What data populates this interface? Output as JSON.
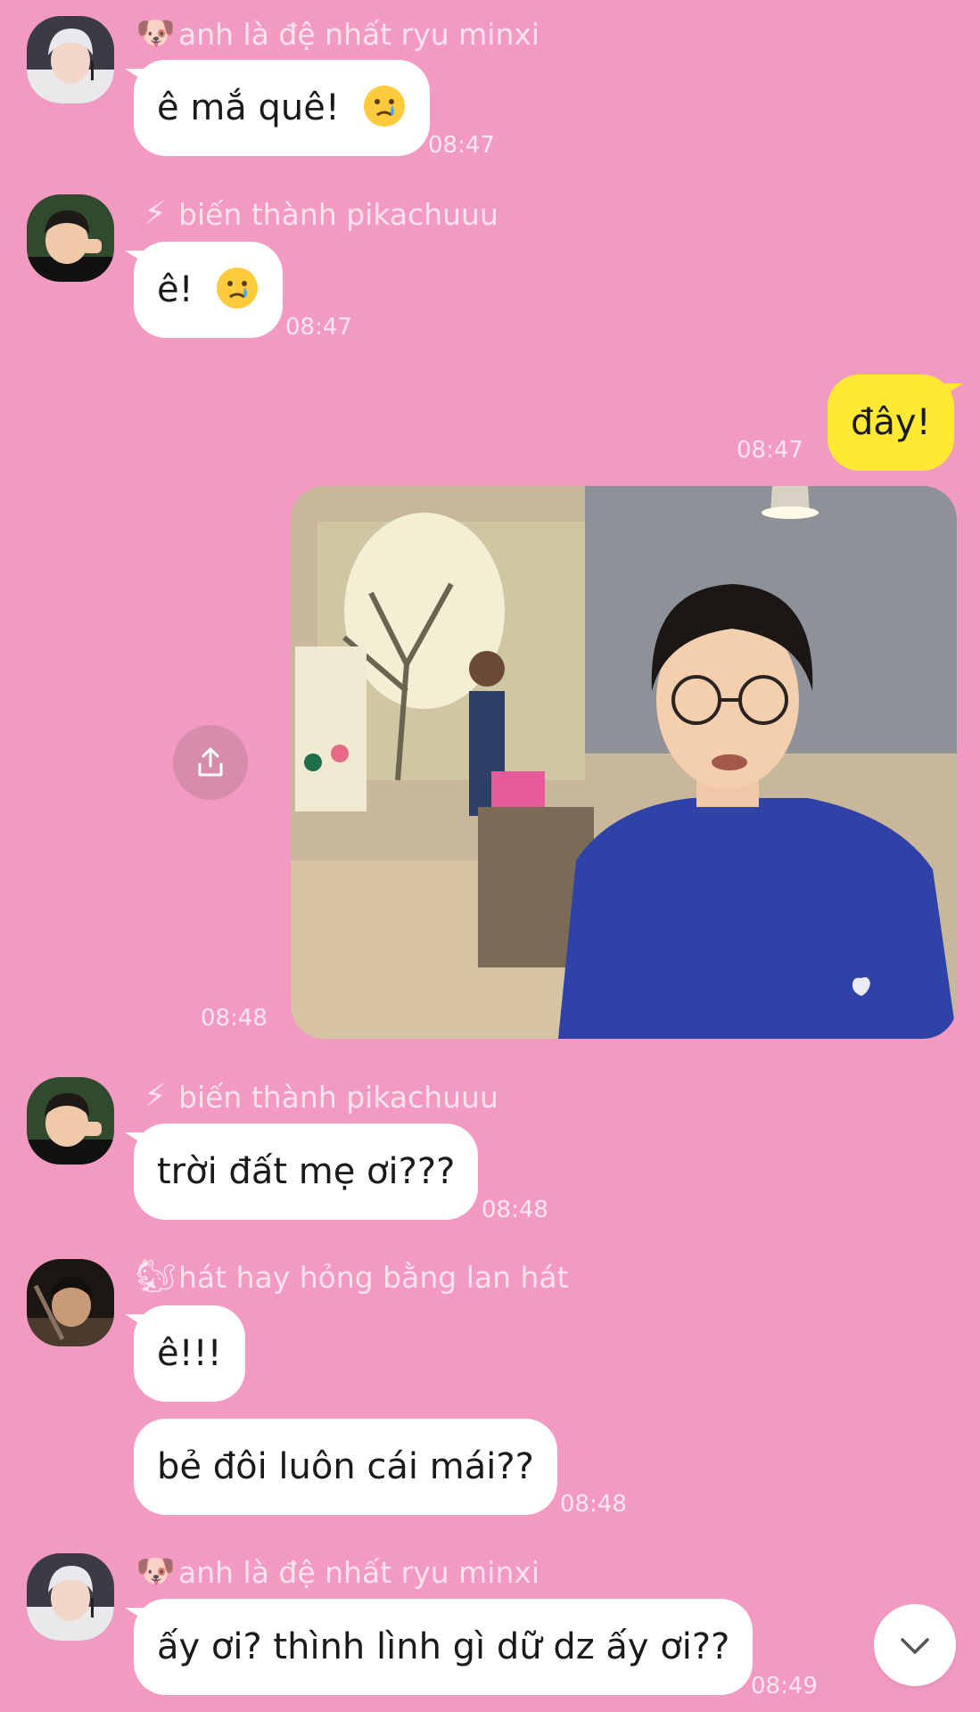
{
  "messages": {
    "m1": {
      "sender": "anh là đệ nhất ryu minxi",
      "sender_icon": "dog-face-icon",
      "text": "ê mắ quê!",
      "emoji": "face-holding-back-tears-icon",
      "time": "08:47"
    },
    "m2": {
      "sender": "biến thành pikachuuu",
      "sender_icon": "lightning-icon",
      "text": "ê!",
      "emoji": "face-holding-back-tears-icon",
      "time": "08:47"
    },
    "m3": {
      "text": "đây!",
      "time": "08:47",
      "mine": true
    },
    "m4": {
      "type": "photo",
      "time": "08:48",
      "share_icon": "share-upload-icon"
    },
    "m5": {
      "sender": "biến thành pikachuuu",
      "sender_icon": "lightning-icon",
      "text": "trời đất mẹ ơi???",
      "time": "08:48"
    },
    "m6": {
      "sender": "hát hay hỏng bằng lan hát",
      "sender_icon": "chipmunk-icon",
      "text": "ê!!!"
    },
    "m7": {
      "text": "bẻ đôi luôn cái mái??",
      "time": "08:48"
    },
    "m8": {
      "sender": "anh là đệ nhất ryu minxi",
      "sender_icon": "dog-face-icon",
      "text": "ấy ơi? thình lình gì dữ dz ấy ơi??",
      "time": "08:49"
    }
  },
  "scroll_button": {
    "icon": "chevron-down-icon"
  },
  "colors": {
    "background": "#f39ac3",
    "bubble_other": "#ffffff",
    "bubble_mine": "#ffe934",
    "meta_text": "rgba(255,255,255,0.75)"
  }
}
